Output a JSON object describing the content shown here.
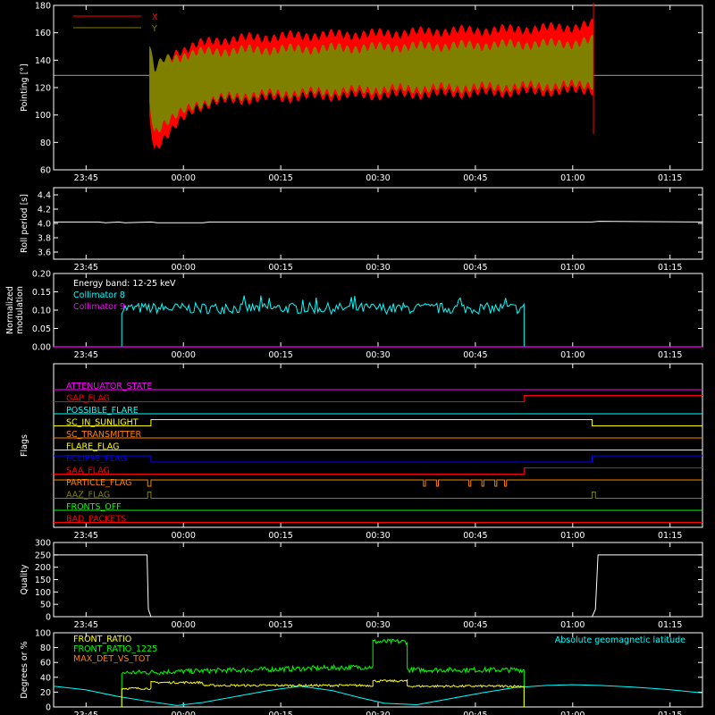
{
  "chart_data": [
    {
      "id": "pointing",
      "type": "area",
      "ylabel": "Pointing [°]",
      "ylim": [
        60,
        180
      ],
      "yticks": [
        60,
        80,
        100,
        120,
        140,
        160,
        180
      ],
      "xlim": [
        -20,
        80
      ],
      "xticks": [
        -15,
        0,
        15,
        30,
        45,
        60,
        75
      ],
      "xticklabels": [
        "23:45",
        "00:00",
        "00:15",
        "00:30",
        "00:45",
        "01:00",
        "01:15"
      ],
      "reference_line": 129,
      "legend": [
        {
          "name": "X",
          "color": "#ff0000"
        },
        {
          "name": "Y",
          "color": "#808000"
        }
      ],
      "series": [
        {
          "name": "X",
          "color": "#ff0000",
          "x": [
            -5.2,
            -4.5,
            -3,
            -1,
            2,
            5,
            10,
            20,
            30,
            40,
            50,
            60,
            63.2
          ],
          "upper": [
            148,
            128,
            138,
            146,
            151,
            154,
            156,
            158,
            159,
            161,
            162,
            164,
            166
          ],
          "lower": [
            100,
            75,
            84,
            93,
            106,
            110,
            112,
            114,
            115,
            116,
            117,
            118,
            119
          ]
        },
        {
          "name": "Y",
          "color": "#808000",
          "x": [
            -5.2,
            -4.5,
            -3,
            -1,
            2,
            5,
            10,
            20,
            30,
            40,
            50,
            60,
            63.2
          ],
          "upper": [
            150,
            132,
            140,
            142,
            145,
            146,
            147,
            148,
            149,
            150,
            151,
            152,
            154
          ],
          "lower": [
            110,
            88,
            95,
            100,
            108,
            112,
            115,
            117,
            119,
            120,
            121,
            122,
            123
          ]
        }
      ]
    },
    {
      "id": "roll-period",
      "type": "line",
      "ylabel": "Roll period [s]",
      "ylim": [
        3.5,
        4.5
      ],
      "yticks": [
        3.6,
        3.8,
        4.0,
        4.2,
        4.4
      ],
      "xlim": [
        -20,
        80
      ],
      "xticks": [
        -15,
        0,
        15,
        30,
        45,
        60,
        75
      ],
      "xticklabels": [
        "23:45",
        "00:00",
        "00:15",
        "00:30",
        "00:45",
        "01:00",
        "01:15"
      ],
      "series": [
        {
          "name": "roll period",
          "color": "#ffffff",
          "x": [
            -20,
            -13,
            -12,
            -10,
            -9,
            -5,
            -4,
            3,
            4,
            63,
            64,
            80
          ],
          "y": [
            4.02,
            4.02,
            4.01,
            4.02,
            4.01,
            4.02,
            4.01,
            4.01,
            4.02,
            4.02,
            4.03,
            4.02
          ]
        }
      ]
    },
    {
      "id": "modulation",
      "type": "line",
      "ylabel": "Normalized modulation",
      "ylim": [
        0,
        0.2
      ],
      "yticks": [
        0.0,
        0.05,
        0.1,
        0.15,
        0.2
      ],
      "xlim": [
        -20,
        80
      ],
      "xticks": [
        -15,
        0,
        15,
        30,
        45,
        60,
        75
      ],
      "xticklabels": [
        "23:45",
        "00:00",
        "00:15",
        "00:30",
        "00:45",
        "01:00",
        "01:15"
      ],
      "annotation": "Energy band: 12-25 keV",
      "series": [
        {
          "name": "Collimator 8",
          "color": "#00ffff",
          "x_start": -9.5,
          "x_end": 52.5,
          "mean": 0.105,
          "spread": 0.03
        },
        {
          "name": "Collimator 9",
          "color": "#ff00ff",
          "x": [
            -20,
            80
          ],
          "y": [
            0,
            0
          ]
        }
      ]
    },
    {
      "id": "flags",
      "type": "line",
      "ylabel": "Flags",
      "xlim": [
        -20,
        80
      ],
      "xticks": [
        -15,
        0,
        15,
        30,
        45,
        60,
        75
      ],
      "xticklabels": [
        "23:45",
        "00:00",
        "00:15",
        "00:30",
        "00:45",
        "01:00",
        "01:15"
      ],
      "series": [
        {
          "name": "ATTENUATOR_STATE",
          "color": "#ff00ff",
          "x": [
            -20,
            80
          ],
          "y": [
            0,
            0
          ]
        },
        {
          "name": "GAP_FLAG",
          "color": "#ff0000",
          "x": [
            -20,
            52.5,
            52.5,
            80
          ],
          "y": [
            0,
            0,
            1,
            1
          ]
        },
        {
          "name": "POSSIBLE_FLARE",
          "color": "#00ffff",
          "x": [
            -20,
            80
          ],
          "y": [
            0,
            0
          ]
        },
        {
          "name": "SC_IN_SUNLIGHT",
          "color": "#ffff00",
          "x": [
            -20,
            -5,
            -5,
            63,
            63,
            80
          ],
          "y": [
            0,
            0,
            1,
            1,
            0,
            0
          ]
        },
        {
          "name": "SC_TRANSMITTER",
          "color": "#ff8000",
          "x": [
            -20,
            80
          ],
          "y": [
            0,
            0
          ]
        },
        {
          "name": "FLARE_FLAG",
          "color": "#ffff00",
          "x": [
            -20,
            80
          ],
          "y": [
            0,
            0
          ]
        },
        {
          "name": "ECLIPSE_FLAG",
          "color": "#0000ff",
          "x": [
            -20,
            -5,
            -5,
            63,
            63,
            80
          ],
          "y": [
            1,
            1,
            0,
            0,
            1,
            1
          ]
        },
        {
          "name": "SAA_FLAG",
          "color": "#ff0000",
          "x": [
            -20,
            -9.5,
            -9.5,
            52.5,
            52.5,
            80
          ],
          "y": [
            0,
            0,
            0,
            0,
            1,
            1
          ]
        },
        {
          "name": "PARTICLE_FLAG",
          "color": "#ff8000",
          "x": [
            -20,
            -5.5,
            -5.5,
            -5,
            -5,
            37,
            37,
            37.3,
            37.3,
            39,
            39,
            39.3,
            39.3,
            44,
            44,
            44.3,
            44.3,
            46,
            46,
            46.3,
            46.3,
            48,
            48,
            48.3,
            48.3,
            49.5,
            49.5,
            49.8,
            49.8,
            80
          ],
          "y": [
            1,
            1,
            0,
            0,
            1,
            1,
            0,
            0,
            1,
            1,
            0,
            0,
            1,
            1,
            0,
            0,
            1,
            1,
            0,
            0,
            1,
            1,
            0,
            0,
            1,
            1,
            0,
            0,
            1,
            1
          ]
        },
        {
          "name": "AAZ_FLAG",
          "color": "#808000",
          "x": [
            -20,
            -5.5,
            -5.5,
            -5,
            -5,
            63,
            63,
            63.5,
            63.5,
            80
          ],
          "y": [
            0,
            0,
            1,
            1,
            0,
            0,
            1,
            1,
            0,
            0
          ]
        },
        {
          "name": "FRONTS_OFF",
          "color": "#00ff00",
          "x": [
            -20,
            80
          ],
          "y": [
            0,
            0
          ]
        },
        {
          "name": "BAD_PACKETS",
          "color": "#ff0000",
          "x": [
            -20,
            80
          ],
          "y": [
            0,
            0
          ]
        }
      ]
    },
    {
      "id": "quality",
      "type": "line",
      "ylabel": "Quality",
      "ylim": [
        0,
        300
      ],
      "yticks": [
        0,
        50,
        100,
        150,
        200,
        250,
        300
      ],
      "xlim": [
        -20,
        80
      ],
      "xticks": [
        -15,
        0,
        15,
        30,
        45,
        60,
        75
      ],
      "xticklabels": [
        "23:45",
        "00:00",
        "00:15",
        "00:30",
        "00:45",
        "01:00",
        "01:15"
      ],
      "series": [
        {
          "name": "quality",
          "color": "#ffffff",
          "x": [
            -20,
            -5.6,
            -5.4,
            -5.0,
            63.0,
            63.5,
            63.9,
            80
          ],
          "y": [
            250,
            250,
            30,
            0,
            0,
            30,
            250,
            250
          ]
        }
      ]
    },
    {
      "id": "ratios",
      "type": "line",
      "ylabel": "Degrees or %",
      "ylim": [
        0,
        100
      ],
      "yticks": [
        0,
        20,
        40,
        60,
        80,
        100
      ],
      "xlim": [
        -20,
        80
      ],
      "xticks": [
        -15,
        0,
        15,
        30,
        45,
        60,
        75
      ],
      "xticklabels": [
        "23:45",
        "00:00",
        "00:15",
        "00:30",
        "00:45",
        "01:00",
        "01:15"
      ],
      "legend": [
        {
          "name": "FRONT_RATIO",
          "color": "#ffff00"
        },
        {
          "name": "FRONT_RATIO_1225",
          "color": "#00ff00"
        },
        {
          "name": "MAX_DET_VS_TOT",
          "color": "#ff8000"
        }
      ],
      "annotation": "Absolute geomagnetic latitude",
      "annotation_color": "#00ffff",
      "series": [
        {
          "name": "FRONT_RATIO",
          "color": "#ffff00",
          "x_start": -9.5,
          "x_end": 52.5,
          "levels": [
            {
              "x0": -9.5,
              "x1": -5,
              "mean": 25
            },
            {
              "x0": -5,
              "x1": 3,
              "mean": 33
            },
            {
              "x0": 3,
              "x1": 29.2,
              "mean": 29
            },
            {
              "x0": 29.2,
              "x1": 34.5,
              "mean": 35
            },
            {
              "x0": 34.5,
              "x1": 52.5,
              "mean": 28
            }
          ],
          "spread": 3
        },
        {
          "name": "FRONT_RATIO_1225",
          "color": "#00ff00",
          "x_start": -9.5,
          "x_end": 52.5,
          "levels": [
            {
              "x0": -9.5,
              "x1": 29.2,
              "mean": 46,
              "trend": 8
            },
            {
              "x0": 29.2,
              "x1": 34.5,
              "mean": 88
            },
            {
              "x0": 34.5,
              "x1": 52.5,
              "mean": 50
            }
          ],
          "spread": 7
        },
        {
          "name": "Absolute geomagnetic latitude",
          "color": "#00ffff",
          "x": [
            -20,
            -15,
            -10,
            -5,
            -1,
            3,
            8,
            13,
            18,
            23,
            27,
            31,
            36,
            41,
            46,
            51,
            56,
            60,
            64,
            69,
            74,
            80
          ],
          "y": [
            28,
            23,
            14,
            7,
            2,
            6,
            14,
            22,
            28,
            22,
            13,
            5,
            3,
            11,
            19,
            26,
            29,
            30,
            29,
            27,
            24,
            19
          ]
        }
      ]
    }
  ]
}
